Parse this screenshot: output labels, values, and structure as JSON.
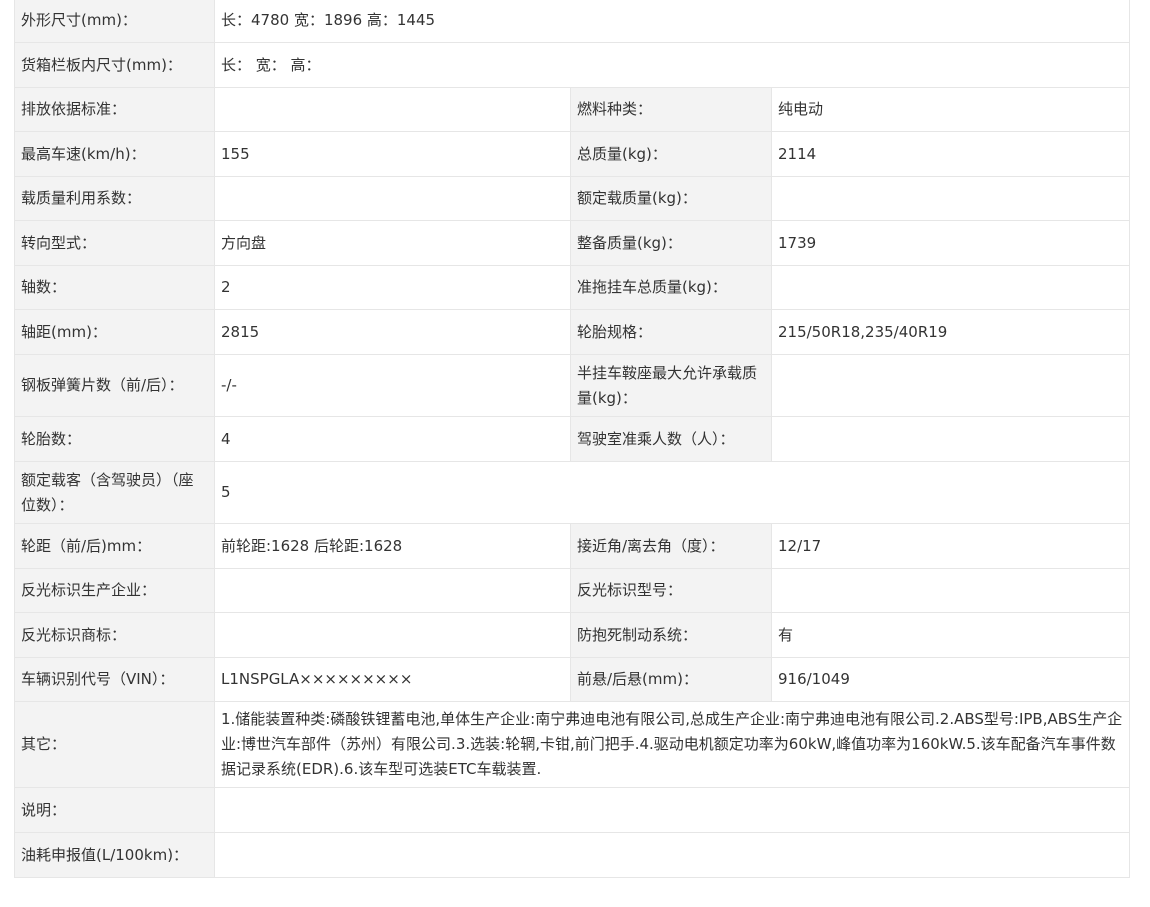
{
  "rows": [
    {
      "label": "外形尺寸(mm)：",
      "value": "长：4780 宽：1896 高：1445"
    },
    {
      "label": "货箱栏板内尺寸(mm)：",
      "value": "长： 宽： 高："
    },
    {
      "label": "排放依据标准：",
      "value": "",
      "label2": "燃料种类：",
      "value2": "纯电动"
    },
    {
      "label": "最高车速(km/h)：",
      "value": "155",
      "label2": "总质量(kg)：",
      "value2": "2114"
    },
    {
      "label": "载质量利用系数：",
      "value": "",
      "label2": "额定载质量(kg)：",
      "value2": ""
    },
    {
      "label": "转向型式：",
      "value": "方向盘",
      "label2": "整备质量(kg)：",
      "value2": "1739"
    },
    {
      "label": "轴数：",
      "value": "2",
      "label2": "准拖挂车总质量(kg)：",
      "value2": ""
    },
    {
      "label": "轴距(mm)：",
      "value": "2815",
      "label2": "轮胎规格：",
      "value2": "215/50R18,235/40R19"
    },
    {
      "label": "钢板弹簧片数（前/后）：",
      "value": "-/-",
      "label2": "半挂车鞍座最大允许承载质量(kg)：",
      "value2": ""
    },
    {
      "label": "轮胎数：",
      "value": "4",
      "label2": "驾驶室准乘人数（人）：",
      "value2": ""
    },
    {
      "label": "额定载客（含驾驶员）（座位数）：",
      "value": "5"
    },
    {
      "label": "轮距（前/后)mm：",
      "value": "前轮距:1628 后轮距:1628",
      "label2": "接近角/离去角（度）：",
      "value2": "12/17"
    },
    {
      "label": "反光标识生产企业：",
      "value": "",
      "label2": "反光标识型号：",
      "value2": ""
    },
    {
      "label": "反光标识商标：",
      "value": "",
      "label2": "防抱死制动系统：",
      "value2": "有"
    },
    {
      "label": "车辆识别代号（VIN）：",
      "value": "L1NSPGLA×××××××××",
      "label2": "前悬/后悬(mm)：",
      "value2": "916/1049"
    },
    {
      "label": "其它：",
      "value": "1.储能装置种类:磷酸铁锂蓄电池,单体生产企业:南宁弗迪电池有限公司,总成生产企业:南宁弗迪电池有限公司.2.ABS型号:IPB,ABS生产企业:博世汽车部件（苏州）有限公司.3.选装:轮辋,卡钳,前门把手.4.驱动电机额定功率为60kW,峰值功率为160kW.5.该车配备汽车事件数据记录系统(EDR).6.该车型可选装ETC车载装置."
    },
    {
      "label": "说明：",
      "value": ""
    },
    {
      "label": "油耗申报值(L/100km)：",
      "value": ""
    }
  ]
}
